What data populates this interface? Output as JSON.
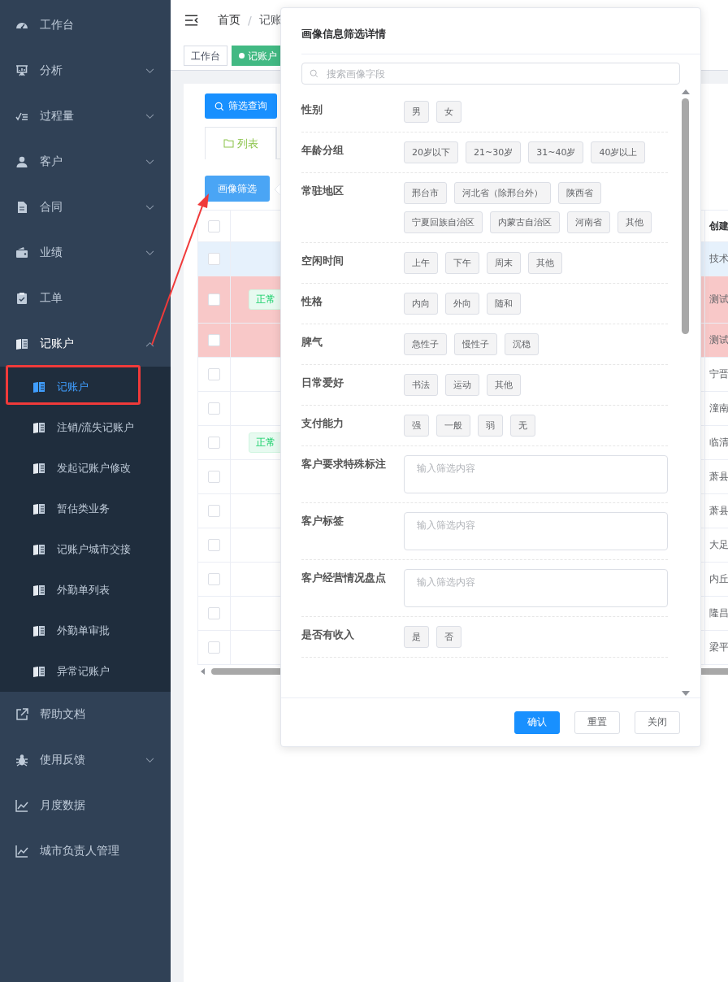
{
  "sidebar": {
    "items": [
      {
        "label": "工作台"
      },
      {
        "label": "分析",
        "expanded": false
      },
      {
        "label": "过程量",
        "expanded": false
      },
      {
        "label": "客户",
        "expanded": false
      },
      {
        "label": "合同",
        "expanded": false
      },
      {
        "label": "业绩",
        "expanded": false
      },
      {
        "label": "工单"
      },
      {
        "label": "记账户",
        "expanded": true,
        "children": [
          {
            "label": "记账户",
            "selected": true
          },
          {
            "label": "注销/流失记账户",
            "selected": false
          },
          {
            "label": "发起记账户修改",
            "selected": false
          },
          {
            "label": "暂估类业务",
            "selected": false
          },
          {
            "label": "记账户城市交接",
            "selected": false
          },
          {
            "label": "外勤单列表",
            "selected": false
          },
          {
            "label": "外勤单审批",
            "selected": false
          },
          {
            "label": "异常记账户",
            "selected": false
          }
        ]
      },
      {
        "label": "帮助文档"
      },
      {
        "label": "使用反馈",
        "expanded": false
      },
      {
        "label": "月度数据"
      },
      {
        "label": "城市负责人管理"
      }
    ]
  },
  "header": {
    "breadcrumb": [
      "首页",
      "记账"
    ],
    "separator": "/"
  },
  "tags_view": [
    {
      "label": "工作台",
      "selected": false
    },
    {
      "label": "记账户",
      "selected": true
    }
  ],
  "query_button": "筛选查询",
  "tabs": [
    {
      "label": "列表",
      "selected": true
    }
  ],
  "profile_button": "画像筛选",
  "table": {
    "header_checked": false,
    "last_column": "创建",
    "rows": [
      {
        "checked": false,
        "selected": true,
        "warning": false,
        "last": "技术"
      },
      {
        "checked": false,
        "selected": false,
        "warning": true,
        "status": "正常",
        "last": "测试"
      },
      {
        "checked": false,
        "selected": false,
        "warning": true,
        "last": "测试"
      },
      {
        "checked": false,
        "selected": false,
        "warning": false,
        "last": "宁晋"
      },
      {
        "checked": false,
        "selected": false,
        "warning": false,
        "last": "潼南"
      },
      {
        "checked": false,
        "selected": false,
        "warning": false,
        "status": "正常",
        "last": "临清"
      },
      {
        "checked": false,
        "selected": false,
        "warning": false,
        "last": "萧县"
      },
      {
        "checked": false,
        "selected": false,
        "warning": false,
        "last": "萧县"
      },
      {
        "checked": false,
        "selected": false,
        "warning": false,
        "last": "大足"
      },
      {
        "checked": false,
        "selected": false,
        "warning": false,
        "last": "内丘"
      },
      {
        "checked": false,
        "selected": false,
        "warning": false,
        "last": "隆昌"
      },
      {
        "checked": false,
        "selected": false,
        "warning": false,
        "last": "梁平"
      }
    ]
  },
  "dialog": {
    "title": "画像信息筛选详情",
    "search": {
      "placeholder": "搜索画像字段"
    },
    "fields": [
      {
        "label": "性别",
        "kind": "tags",
        "options": [
          {
            "label": "男",
            "selected": false
          },
          {
            "label": "女",
            "selected": false
          }
        ]
      },
      {
        "label": "年龄分组",
        "kind": "tags",
        "options": [
          {
            "label": "20岁以下",
            "selected": false
          },
          {
            "label": "21~30岁",
            "selected": false
          },
          {
            "label": "31~40岁",
            "selected": false
          },
          {
            "label": "40岁以上",
            "selected": false
          }
        ]
      },
      {
        "label": "常驻地区",
        "kind": "tags",
        "options": [
          {
            "label": "邢台市",
            "selected": false
          },
          {
            "label": "河北省（除邢台外）",
            "selected": false
          },
          {
            "label": "陕西省",
            "selected": false
          },
          {
            "label": "宁夏回族自治区",
            "selected": false
          },
          {
            "label": "内蒙古自治区",
            "selected": false
          },
          {
            "label": "河南省",
            "selected": false
          },
          {
            "label": "其他",
            "selected": false
          }
        ]
      },
      {
        "label": "空闲时间",
        "kind": "tags",
        "options": [
          {
            "label": "上午",
            "selected": false
          },
          {
            "label": "下午",
            "selected": false
          },
          {
            "label": "周末",
            "selected": false
          },
          {
            "label": "其他",
            "selected": false
          }
        ]
      },
      {
        "label": "性格",
        "kind": "tags",
        "options": [
          {
            "label": "内向",
            "selected": false
          },
          {
            "label": "外向",
            "selected": false
          },
          {
            "label": "随和",
            "selected": false
          }
        ]
      },
      {
        "label": "脾气",
        "kind": "tags",
        "options": [
          {
            "label": "急性子",
            "selected": false
          },
          {
            "label": "慢性子",
            "selected": false
          },
          {
            "label": "沉稳",
            "selected": false
          }
        ]
      },
      {
        "label": "日常爱好",
        "kind": "tags",
        "options": [
          {
            "label": "书法",
            "selected": false
          },
          {
            "label": "运动",
            "selected": false
          },
          {
            "label": "其他",
            "selected": false
          }
        ]
      },
      {
        "label": "支付能力",
        "kind": "tags",
        "options": [
          {
            "label": "强",
            "selected": false
          },
          {
            "label": "一般",
            "selected": false
          },
          {
            "label": "弱",
            "selected": false
          },
          {
            "label": "无",
            "selected": false
          }
        ]
      },
      {
        "label": "客户要求特殊标注",
        "kind": "text",
        "placeholder": "输入筛选内容"
      },
      {
        "label": "客户标签",
        "kind": "text",
        "placeholder": "输入筛选内容"
      },
      {
        "label": "客户经营情况盘点",
        "kind": "text",
        "placeholder": "输入筛选内容"
      },
      {
        "label": "是否有收入",
        "kind": "tags",
        "options": [
          {
            "label": "是",
            "selected": false
          },
          {
            "label": "否",
            "selected": false
          }
        ]
      }
    ],
    "buttons": [
      {
        "label": "确认",
        "kind": "primary"
      },
      {
        "label": "重置",
        "kind": "default"
      },
      {
        "label": "关闭",
        "kind": "default"
      }
    ]
  }
}
